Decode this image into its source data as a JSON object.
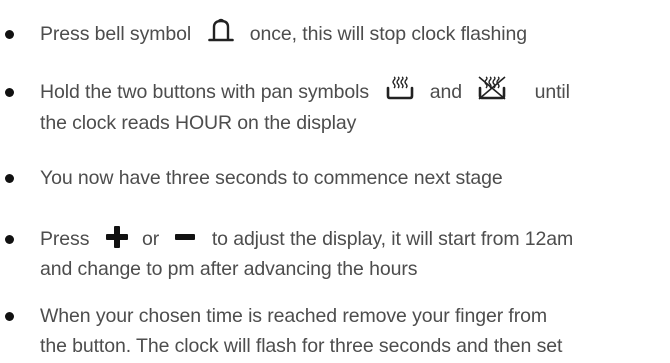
{
  "instructions": {
    "items": [
      {
        "parts": [
          {
            "text": "Press bell symbol"
          },
          {
            "icon": "bell-icon"
          },
          {
            "text": "once, this will stop clock flashing"
          }
        ]
      },
      {
        "parts": [
          {
            "text": "Hold the two buttons with pan symbols"
          },
          {
            "icon": "pan-heat-icon"
          },
          {
            "text": "and"
          },
          {
            "icon": "pan-heat-off-icon"
          },
          {
            "text": "until"
          }
        ],
        "line2": "the clock reads HOUR on the display"
      },
      {
        "parts": [
          {
            "text": "You now have three seconds to commence next stage"
          }
        ]
      },
      {
        "parts": [
          {
            "text": "Press"
          },
          {
            "icon": "plus-icon"
          },
          {
            "text": "or"
          },
          {
            "icon": "minus-icon"
          },
          {
            "text": "to adjust the display, it will start from 12am"
          }
        ],
        "line2": "and change to pm after advancing the hours"
      },
      {
        "parts": [
          {
            "text": "When your chosen time is reached remove your finger from"
          }
        ],
        "line2": "the button. The clock will flash for three seconds and then set"
      }
    ]
  }
}
